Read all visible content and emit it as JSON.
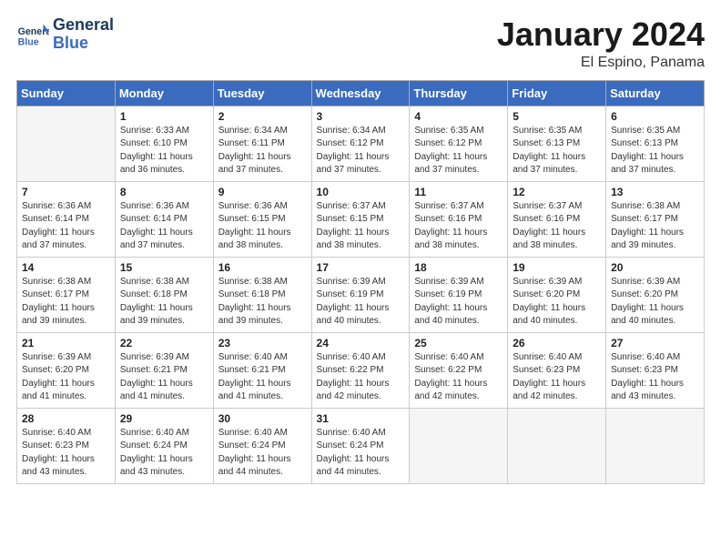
{
  "logo": {
    "text_general": "General",
    "text_blue": "Blue"
  },
  "header": {
    "month_year": "January 2024",
    "location": "El Espino, Panama"
  },
  "days_of_week": [
    "Sunday",
    "Monday",
    "Tuesday",
    "Wednesday",
    "Thursday",
    "Friday",
    "Saturday"
  ],
  "weeks": [
    [
      {
        "day": "",
        "empty": true
      },
      {
        "day": "1",
        "sunrise": "6:33 AM",
        "sunset": "6:10 PM",
        "daylight": "11 hours and 36 minutes."
      },
      {
        "day": "2",
        "sunrise": "6:34 AM",
        "sunset": "6:11 PM",
        "daylight": "11 hours and 37 minutes."
      },
      {
        "day": "3",
        "sunrise": "6:34 AM",
        "sunset": "6:12 PM",
        "daylight": "11 hours and 37 minutes."
      },
      {
        "day": "4",
        "sunrise": "6:35 AM",
        "sunset": "6:12 PM",
        "daylight": "11 hours and 37 minutes."
      },
      {
        "day": "5",
        "sunrise": "6:35 AM",
        "sunset": "6:13 PM",
        "daylight": "11 hours and 37 minutes."
      },
      {
        "day": "6",
        "sunrise": "6:35 AM",
        "sunset": "6:13 PM",
        "daylight": "11 hours and 37 minutes."
      }
    ],
    [
      {
        "day": "7",
        "sunrise": "6:36 AM",
        "sunset": "6:14 PM",
        "daylight": "11 hours and 37 minutes."
      },
      {
        "day": "8",
        "sunrise": "6:36 AM",
        "sunset": "6:14 PM",
        "daylight": "11 hours and 37 minutes."
      },
      {
        "day": "9",
        "sunrise": "6:36 AM",
        "sunset": "6:15 PM",
        "daylight": "11 hours and 38 minutes."
      },
      {
        "day": "10",
        "sunrise": "6:37 AM",
        "sunset": "6:15 PM",
        "daylight": "11 hours and 38 minutes."
      },
      {
        "day": "11",
        "sunrise": "6:37 AM",
        "sunset": "6:16 PM",
        "daylight": "11 hours and 38 minutes."
      },
      {
        "day": "12",
        "sunrise": "6:37 AM",
        "sunset": "6:16 PM",
        "daylight": "11 hours and 38 minutes."
      },
      {
        "day": "13",
        "sunrise": "6:38 AM",
        "sunset": "6:17 PM",
        "daylight": "11 hours and 39 minutes."
      }
    ],
    [
      {
        "day": "14",
        "sunrise": "6:38 AM",
        "sunset": "6:17 PM",
        "daylight": "11 hours and 39 minutes."
      },
      {
        "day": "15",
        "sunrise": "6:38 AM",
        "sunset": "6:18 PM",
        "daylight": "11 hours and 39 minutes."
      },
      {
        "day": "16",
        "sunrise": "6:38 AM",
        "sunset": "6:18 PM",
        "daylight": "11 hours and 39 minutes."
      },
      {
        "day": "17",
        "sunrise": "6:39 AM",
        "sunset": "6:19 PM",
        "daylight": "11 hours and 40 minutes."
      },
      {
        "day": "18",
        "sunrise": "6:39 AM",
        "sunset": "6:19 PM",
        "daylight": "11 hours and 40 minutes."
      },
      {
        "day": "19",
        "sunrise": "6:39 AM",
        "sunset": "6:20 PM",
        "daylight": "11 hours and 40 minutes."
      },
      {
        "day": "20",
        "sunrise": "6:39 AM",
        "sunset": "6:20 PM",
        "daylight": "11 hours and 40 minutes."
      }
    ],
    [
      {
        "day": "21",
        "sunrise": "6:39 AM",
        "sunset": "6:20 PM",
        "daylight": "11 hours and 41 minutes."
      },
      {
        "day": "22",
        "sunrise": "6:39 AM",
        "sunset": "6:21 PM",
        "daylight": "11 hours and 41 minutes."
      },
      {
        "day": "23",
        "sunrise": "6:40 AM",
        "sunset": "6:21 PM",
        "daylight": "11 hours and 41 minutes."
      },
      {
        "day": "24",
        "sunrise": "6:40 AM",
        "sunset": "6:22 PM",
        "daylight": "11 hours and 42 minutes."
      },
      {
        "day": "25",
        "sunrise": "6:40 AM",
        "sunset": "6:22 PM",
        "daylight": "11 hours and 42 minutes."
      },
      {
        "day": "26",
        "sunrise": "6:40 AM",
        "sunset": "6:23 PM",
        "daylight": "11 hours and 42 minutes."
      },
      {
        "day": "27",
        "sunrise": "6:40 AM",
        "sunset": "6:23 PM",
        "daylight": "11 hours and 43 minutes."
      }
    ],
    [
      {
        "day": "28",
        "sunrise": "6:40 AM",
        "sunset": "6:23 PM",
        "daylight": "11 hours and 43 minutes."
      },
      {
        "day": "29",
        "sunrise": "6:40 AM",
        "sunset": "6:24 PM",
        "daylight": "11 hours and 43 minutes."
      },
      {
        "day": "30",
        "sunrise": "6:40 AM",
        "sunset": "6:24 PM",
        "daylight": "11 hours and 44 minutes."
      },
      {
        "day": "31",
        "sunrise": "6:40 AM",
        "sunset": "6:24 PM",
        "daylight": "11 hours and 44 minutes."
      },
      {
        "day": "",
        "empty": true
      },
      {
        "day": "",
        "empty": true
      },
      {
        "day": "",
        "empty": true
      }
    ]
  ]
}
